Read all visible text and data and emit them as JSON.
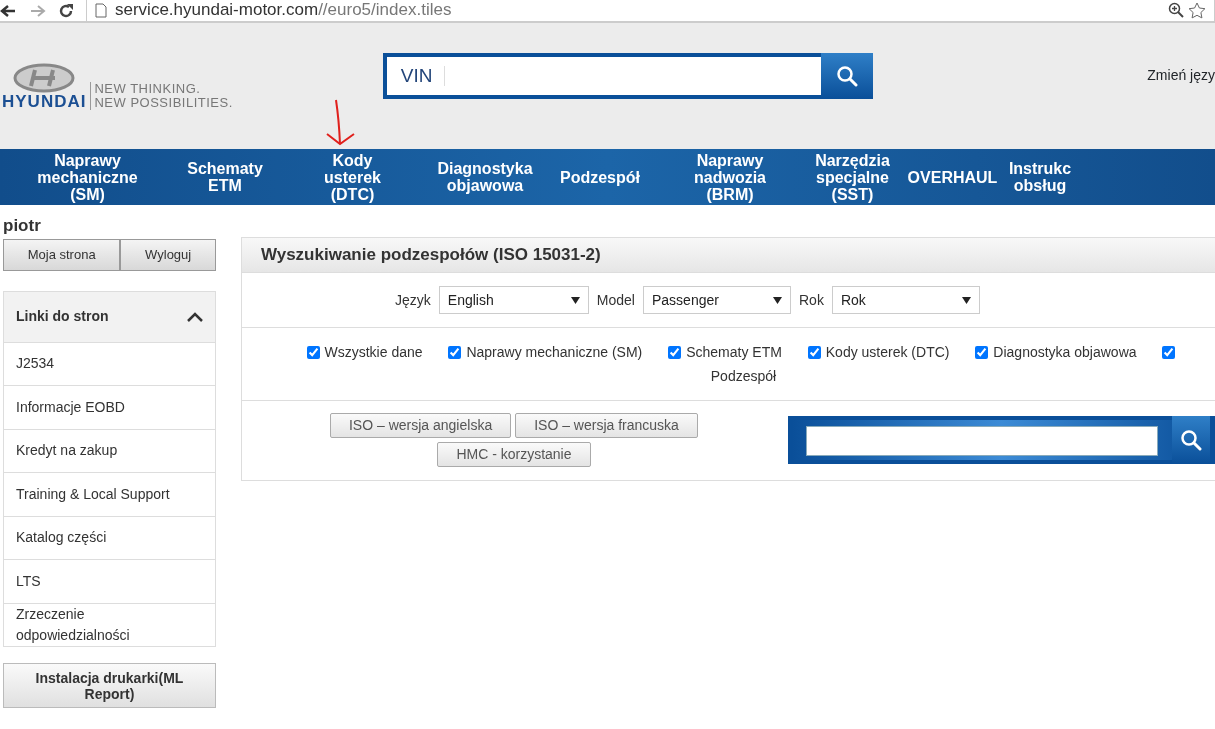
{
  "browser": {
    "url_host": "service.hyundai-motor.com",
    "url_path": "//euro5/index.tiles"
  },
  "header": {
    "brand": "HYUNDAI",
    "slogan": "NEW THINKING.\nNEW POSSIBILITIES.",
    "vin_label": "VIN",
    "language_link": "Zmień języ"
  },
  "nav": [
    {
      "label": "Naprawy\nmechaniczne\n(SM)",
      "annotated": false
    },
    {
      "label": "Schematy\nETM",
      "annotated": false
    },
    {
      "label": "Kody\nusterek\n(DTC)",
      "annotated": true
    },
    {
      "label": "Diagnostyka\nobjawowa",
      "annotated": false
    },
    {
      "label": "Podzespół",
      "annotated": false
    },
    {
      "label": "Naprawy\nnadwozia\n(BRM)",
      "annotated": false
    },
    {
      "label": "Narzędzia\nspecjalne\n(SST)",
      "annotated": false
    },
    {
      "label": "OVERHAUL",
      "annotated": false
    },
    {
      "label": "Instrukc\nobsług",
      "annotated": false
    }
  ],
  "sidebar": {
    "user": "piotr",
    "buttons": [
      "Moja strona",
      "Wyloguj"
    ],
    "links_title": "Linki do stron",
    "expanded": true,
    "links": [
      "J2534",
      "Informacje EOBD",
      "Kredyt na zakup",
      "Training & Local Support",
      "Katalog części",
      "LTS",
      "Zrzeczenie odpowiedzialności"
    ],
    "printer_button": "Instalacja drukarki(ML Report)"
  },
  "panel": {
    "title": "Wyszukiwanie podzespołów (ISO 15031-2)",
    "filters": [
      {
        "label": "Język",
        "value": "English"
      },
      {
        "label": "Model",
        "value": "Passenger"
      },
      {
        "label": "Rok",
        "value": "Rok"
      }
    ],
    "checkboxes": [
      {
        "label": "Wszystkie dane",
        "checked": true
      },
      {
        "label": "Naprawy mechaniczne (SM)",
        "checked": true
      },
      {
        "label": "Schematy ETM",
        "checked": true
      },
      {
        "label": "Kody usterek (DTC)",
        "checked": true
      },
      {
        "label": "Diagnostyka objawowa",
        "checked": true
      },
      {
        "label": "Podzespół",
        "checked": true
      }
    ],
    "buttons": [
      "ISO – wersja angielska",
      "ISO – wersja francuska",
      "HMC - korzystanie"
    ]
  }
}
